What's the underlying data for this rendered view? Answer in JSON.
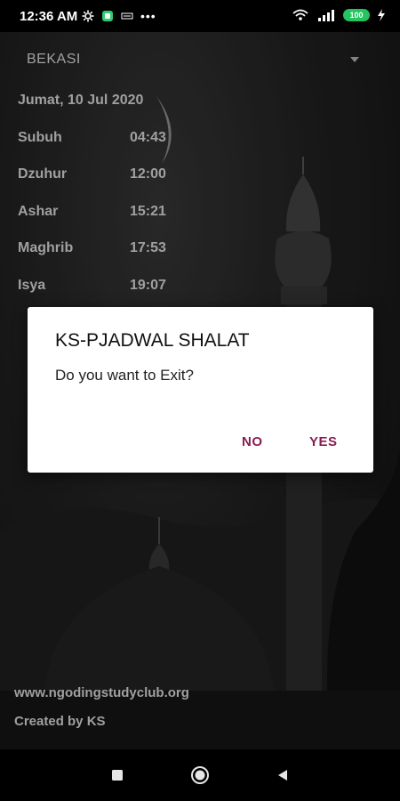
{
  "status_bar": {
    "time": "12:36 AM",
    "battery": "100"
  },
  "app": {
    "location": "BEKASI",
    "date": "Jumat, 10 Jul 2020",
    "prayers": [
      {
        "name": "Subuh",
        "time": "04:43"
      },
      {
        "name": "Dzuhur",
        "time": "12:00"
      },
      {
        "name": "Ashar",
        "time": "15:21"
      },
      {
        "name": "Maghrib",
        "time": "17:53"
      },
      {
        "name": "Isya",
        "time": "19:07"
      }
    ],
    "footer": {
      "website": "www.ngodingstudyclub.org",
      "credit": "Created by KS"
    }
  },
  "dialog": {
    "title": "KS-PJADWAL SHALAT",
    "message": "Do you want to Exit?",
    "no_label": "NO",
    "yes_label": "YES",
    "accent_color": "#8a1c52"
  },
  "nav": {
    "icons": [
      "recents-icon",
      "home-icon",
      "back-icon"
    ]
  }
}
